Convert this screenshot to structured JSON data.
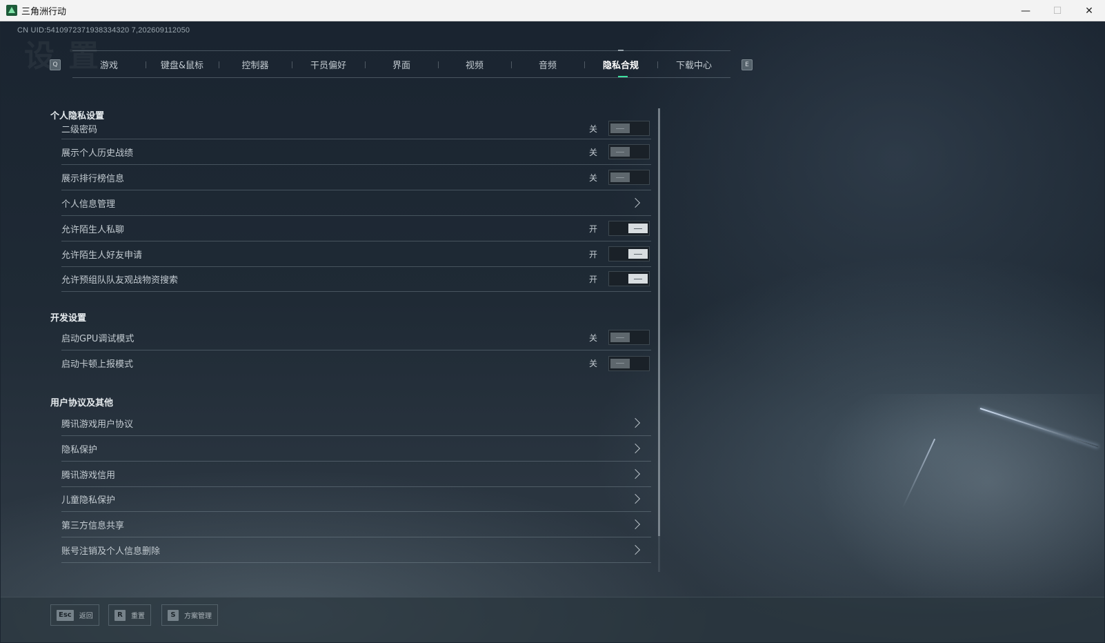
{
  "window": {
    "title": "三角洲行动",
    "controls": {
      "minimize": "—",
      "maximize": "☐",
      "close": "✕"
    }
  },
  "uid_text": "CN UID:5410972371938334320 7,202609112050",
  "watermark": "设置",
  "tabs": {
    "prev_key": "Q",
    "next_key": "E",
    "items": [
      {
        "label": "游戏",
        "active": false
      },
      {
        "label": "键盘&鼠标",
        "active": false
      },
      {
        "label": "控制器",
        "active": false
      },
      {
        "label": "干员偏好",
        "active": false
      },
      {
        "label": "界面",
        "active": false
      },
      {
        "label": "视频",
        "active": false
      },
      {
        "label": "音频",
        "active": false
      },
      {
        "label": "隐私合规",
        "active": true
      },
      {
        "label": "下载中心",
        "active": false
      }
    ]
  },
  "sections": {
    "privacy": {
      "title": "个人隐私设置",
      "rows": [
        {
          "label": "二级密码",
          "state": "关",
          "type": "toggle",
          "on": false
        },
        {
          "label": "展示个人历史战绩",
          "state": "关",
          "type": "toggle",
          "on": false
        },
        {
          "label": "展示排行榜信息",
          "state": "关",
          "type": "toggle",
          "on": false
        },
        {
          "label": "个人信息管理",
          "type": "link"
        },
        {
          "label": "允许陌生人私聊",
          "state": "开",
          "type": "toggle",
          "on": true
        },
        {
          "label": "允许陌生人好友申请",
          "state": "开",
          "type": "toggle",
          "on": true
        },
        {
          "label": "允许预组队队友观战物资搜索",
          "state": "开",
          "type": "toggle",
          "on": true
        }
      ]
    },
    "dev": {
      "title": "开发设置",
      "rows": [
        {
          "label": "启动GPU调试模式",
          "state": "关",
          "type": "toggle",
          "on": false
        },
        {
          "label": "启动卡顿上报模式",
          "state": "关",
          "type": "toggle",
          "on": false
        }
      ]
    },
    "agreements": {
      "title": "用户协议及其他",
      "rows": [
        {
          "label": "腾讯游戏用户协议",
          "type": "link"
        },
        {
          "label": "隐私保护",
          "type": "link"
        },
        {
          "label": "腾讯游戏信用",
          "type": "link"
        },
        {
          "label": "儿童隐私保护",
          "type": "link"
        },
        {
          "label": "第三方信息共享",
          "type": "link"
        },
        {
          "label": "账号注销及个人信息删除",
          "type": "link"
        }
      ]
    }
  },
  "bottom_hints": [
    {
      "key": "Esc",
      "label": "返回"
    },
    {
      "key": "R",
      "label": "重置"
    },
    {
      "key": "S",
      "label": "方案管理"
    }
  ]
}
